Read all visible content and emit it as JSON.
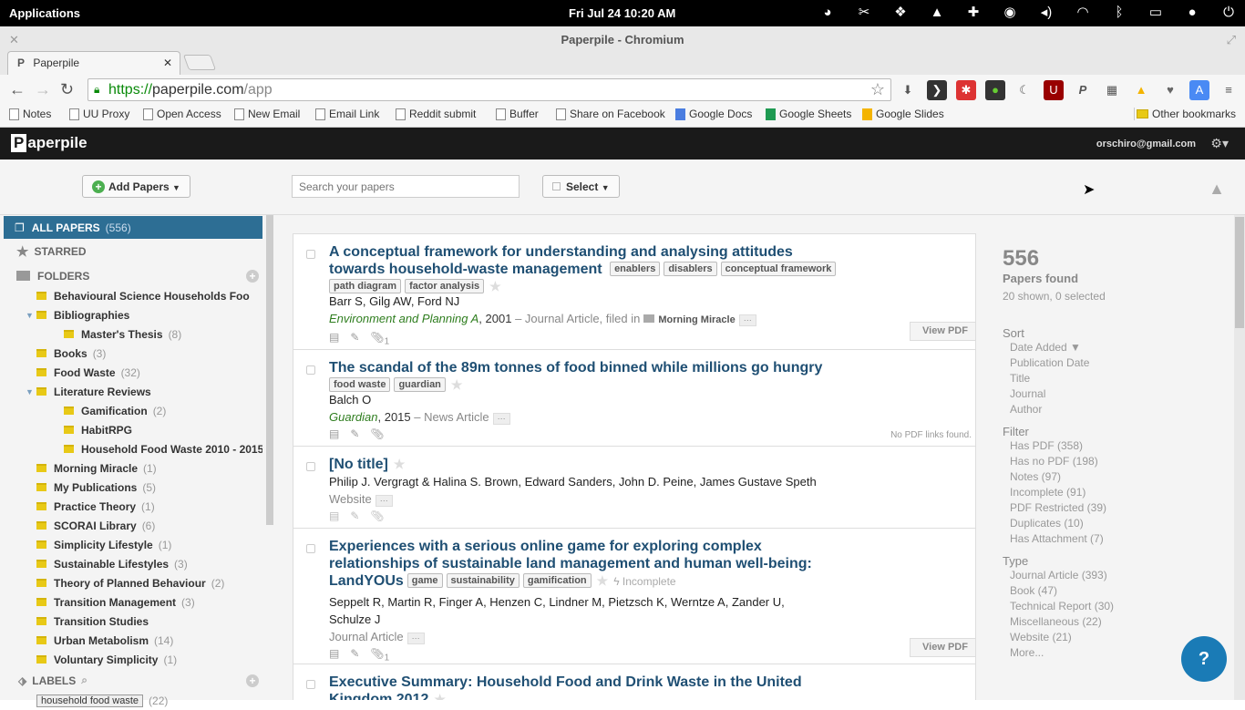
{
  "system": {
    "apps": "Applications",
    "clock": "Fri Jul 24   10:20 AM"
  },
  "window": {
    "title": "Paperpile - Chromium"
  },
  "tab": {
    "label": "Paperpile"
  },
  "address": {
    "https": "https://",
    "domain": "paperpile.com",
    "path": "/app"
  },
  "bookmarks": [
    "Notes",
    "UU Proxy",
    "Open Access",
    "New Email",
    "Email Link",
    "Reddit submit",
    "Buffer",
    "Share on Facebook",
    "Google Docs",
    "Google Sheets",
    "Google Slides",
    "Other bookmarks"
  ],
  "app": {
    "logo": "aperpile",
    "logo_p": "P",
    "user": "orschiro@gmail.com"
  },
  "toolbar": {
    "add_papers": "Add Papers",
    "search_placeholder": "Search your papers",
    "select": "Select"
  },
  "sidebar": {
    "all_papers": "ALL PAPERS",
    "all_count": "(556)",
    "starred": "STARRED",
    "folders": "FOLDERS",
    "labels": "LABELS",
    "items": [
      {
        "label": "Behavioural Science Households Foo",
        "count": "",
        "indent": 0,
        "tri": ""
      },
      {
        "label": "Bibliographies",
        "count": "",
        "indent": 0,
        "tri": "▼"
      },
      {
        "label": "Master's Thesis",
        "count": "(8)",
        "indent": 1,
        "tri": ""
      },
      {
        "label": "Books",
        "count": "(3)",
        "indent": 0,
        "tri": ""
      },
      {
        "label": "Food Waste",
        "count": "(32)",
        "indent": 0,
        "tri": ""
      },
      {
        "label": "Literature Reviews",
        "count": "",
        "indent": 0,
        "tri": "▼"
      },
      {
        "label": "Gamification",
        "count": "(2)",
        "indent": 1,
        "tri": ""
      },
      {
        "label": "HabitRPG",
        "count": "",
        "indent": 1,
        "tri": ""
      },
      {
        "label": "Household Food Waste 2010 - 2015",
        "count": "",
        "indent": 1,
        "tri": ""
      },
      {
        "label": "Morning Miracle",
        "count": "(1)",
        "indent": 0,
        "tri": ""
      },
      {
        "label": "My Publications",
        "count": "(5)",
        "indent": 0,
        "tri": ""
      },
      {
        "label": "Practice Theory",
        "count": "(1)",
        "indent": 0,
        "tri": ""
      },
      {
        "label": "SCORAI Library",
        "count": "(6)",
        "indent": 0,
        "tri": ""
      },
      {
        "label": "Simplicity Lifestyle",
        "count": "(1)",
        "indent": 0,
        "tri": ""
      },
      {
        "label": "Sustainable Lifestyles",
        "count": "(3)",
        "indent": 0,
        "tri": ""
      },
      {
        "label": "Theory of Planned Behaviour",
        "count": "(2)",
        "indent": 0,
        "tri": ""
      },
      {
        "label": "Transition Management",
        "count": "(3)",
        "indent": 0,
        "tri": ""
      },
      {
        "label": "Transition Studies",
        "count": "",
        "indent": 0,
        "tri": ""
      },
      {
        "label": "Urban Metabolism",
        "count": "(14)",
        "indent": 0,
        "tri": ""
      },
      {
        "label": "Voluntary Simplicity",
        "count": "(1)",
        "indent": 0,
        "tri": ""
      }
    ],
    "first_label": "household food waste",
    "first_label_count": "(22)"
  },
  "papers": [
    {
      "title1": "A conceptual framework for understanding and analysing attitudes",
      "title2": "towards household-waste management",
      "tags_inline": [
        "enablers",
        "disablers",
        "conceptual framework"
      ],
      "tags_next": [
        "path diagram",
        "factor analysis"
      ],
      "authors": "Barr S, Gilg AW, Ford NJ",
      "journal": "Environment and Planning A",
      "year": ", 2001",
      "type": " – Journal Article, filed in",
      "collection": "Morning Miracle",
      "attach": "1",
      "pdf": "View PDF"
    },
    {
      "title1": "The scandal of the 89m tonnes of food binned while millions go hungry",
      "tags_next": [
        "food waste",
        "guardian"
      ],
      "authors": "Balch O",
      "journal": "Guardian",
      "year": ", 2015",
      "type": " – News Article",
      "pdf": "No PDF links found."
    },
    {
      "title1": "[No title]",
      "authors": "Philip J. Vergragt & Halina S. Brown, Edward Sanders, John D. Peine, James Gustave Speth",
      "type": "Website"
    },
    {
      "title1": "Experiences with a serious online game for exploring complex",
      "title2": "relationships of sustainable land management and human well-being:",
      "title3": "LandYOUs",
      "tags_inline": [
        "game",
        "sustainability",
        "gamification"
      ],
      "incomplete": "Incomplete",
      "authors": "Seppelt R, Martin R, Finger A, Henzen C, Lindner M, Pietzsch K, Werntze A, Zander U,",
      "authors2": "Schulze J",
      "type": "Journal Article",
      "attach": "1",
      "pdf": "View PDF"
    },
    {
      "title1": "Executive Summary: Household Food and Drink Waste in the United",
      "title2": "Kingdom 2012"
    }
  ],
  "summary": {
    "count": "556",
    "found": "Papers found",
    "shown": "20 shown, 0 selected",
    "sort_h": "Sort",
    "sort": [
      "Date Added ▼",
      "Publication Date",
      "Title",
      "Journal",
      "Author"
    ],
    "filter_h": "Filter",
    "filter": [
      "Has PDF (358)",
      "Has no PDF (198)",
      "Notes (97)",
      "Incomplete (91)",
      "PDF Restricted (39)",
      "Duplicates (10)",
      "Has Attachment (7)"
    ],
    "type_h": "Type",
    "types": [
      "Journal Article (393)",
      "Book (47)",
      "Technical Report (30)",
      "Miscellaneous (22)",
      "Website (21)",
      "More..."
    ]
  },
  "help": "?"
}
